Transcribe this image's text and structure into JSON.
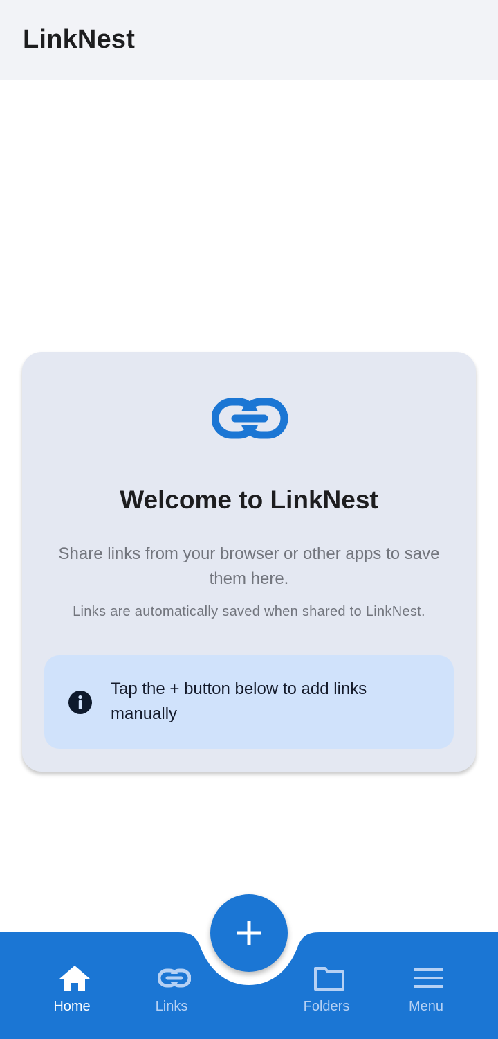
{
  "app": {
    "title": "LinkNest"
  },
  "welcome": {
    "icon": "link-icon",
    "title": "Welcome to LinkNest",
    "description": "Share links from your browser or other apps to save them here.",
    "note": "Links are automatically saved when shared to LinkNest.",
    "tip": {
      "icon": "info-icon",
      "text": "Tap the + button below to add links manually"
    }
  },
  "bottom_nav": {
    "items": [
      {
        "label": "Home",
        "icon": "home-icon",
        "active": true
      },
      {
        "label": "Links",
        "icon": "link-icon",
        "active": false
      },
      {
        "label": "Folders",
        "icon": "folder-icon",
        "active": false
      },
      {
        "label": "Menu",
        "icon": "menu-icon",
        "active": false
      }
    ],
    "fab_icon": "plus-icon"
  },
  "colors": {
    "primary": "#1b76d4",
    "app_bar_bg": "#f2f3f7",
    "card_bg": "#e4e8f2",
    "tip_bg": "#d0e2fb",
    "nav_inactive": "#b6d1f4",
    "text_primary": "#1d1d1f",
    "text_secondary": "#72757d"
  }
}
